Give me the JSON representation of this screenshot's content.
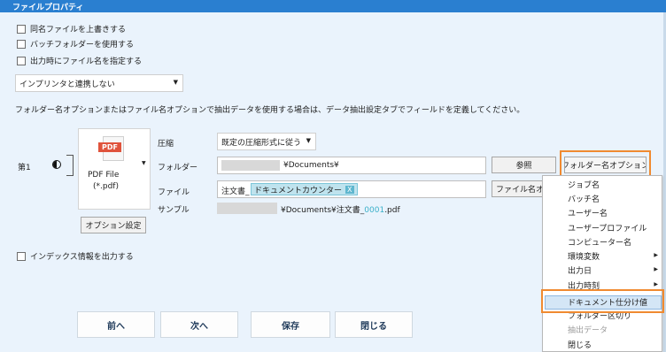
{
  "window": {
    "title": "ファイルプロパティ"
  },
  "options": {
    "overwrite_label": "同名ファイルを上書きする",
    "batch_folder_label": "バッチフォルダーを使用する",
    "specify_name_label": "出力時にファイル名を指定する"
  },
  "printer_select": {
    "value": "インプリンタと連携しない"
  },
  "info_text": "フォルダー名オプションまたはファイル名オプションで抽出データを使用する場合は、データ抽出設定タブでフィールドを定義してください。",
  "row": {
    "number_label": "第1"
  },
  "file_type": {
    "badge": "PDF",
    "name": "PDF File",
    "ext": "(*.pdf)"
  },
  "option_settings_label": "オプション設定",
  "compression": {
    "label": "圧縮",
    "value": "既定の圧縮形式に従う"
  },
  "folder": {
    "label": "フォルダー",
    "value": "¥Documents¥",
    "browse_label": "参照",
    "option_label": "フォルダー名オプション"
  },
  "file": {
    "label": "ファイル",
    "prefix": "注文書_",
    "token": "ドキュメントカウンター",
    "token_remove": "X",
    "option_label": "ファイル名オプション"
  },
  "sample": {
    "label": "サンプル",
    "path": "¥Documents¥注文書_",
    "counter": "0001",
    "ext": ".pdf"
  },
  "index_label": "インデックス情報を出力する",
  "nav": {
    "prev": "前へ",
    "next": "次へ",
    "save": "保存",
    "close": "閉じる"
  },
  "context_menu": {
    "items": [
      {
        "label": "ジョブ名",
        "submenu": false,
        "disabled": false
      },
      {
        "label": "バッチ名",
        "submenu": false,
        "disabled": false
      },
      {
        "label": "ユーザー名",
        "submenu": false,
        "disabled": false
      },
      {
        "label": "ユーザープロファイル",
        "submenu": false,
        "disabled": false
      },
      {
        "label": "コンピューター名",
        "submenu": false,
        "disabled": false
      },
      {
        "label": "環境変数",
        "submenu": true,
        "disabled": false
      },
      {
        "label": "出力日",
        "submenu": true,
        "disabled": false
      },
      {
        "label": "出力時刻",
        "submenu": true,
        "disabled": false
      },
      {
        "label": "ドキュメント仕分け値",
        "submenu": false,
        "disabled": false
      },
      {
        "label": "フォルダー区切り",
        "submenu": false,
        "disabled": false
      },
      {
        "label": "抽出データ",
        "submenu": false,
        "disabled": true
      },
      {
        "label": "閉じる",
        "submenu": false,
        "disabled": false
      }
    ]
  },
  "colors": {
    "accent": "#2a7fd0",
    "highlight": "#f08a30",
    "pdf_red": "#e0533c",
    "token_bg": "#bfe3ee",
    "counter": "#3bb0c9"
  }
}
